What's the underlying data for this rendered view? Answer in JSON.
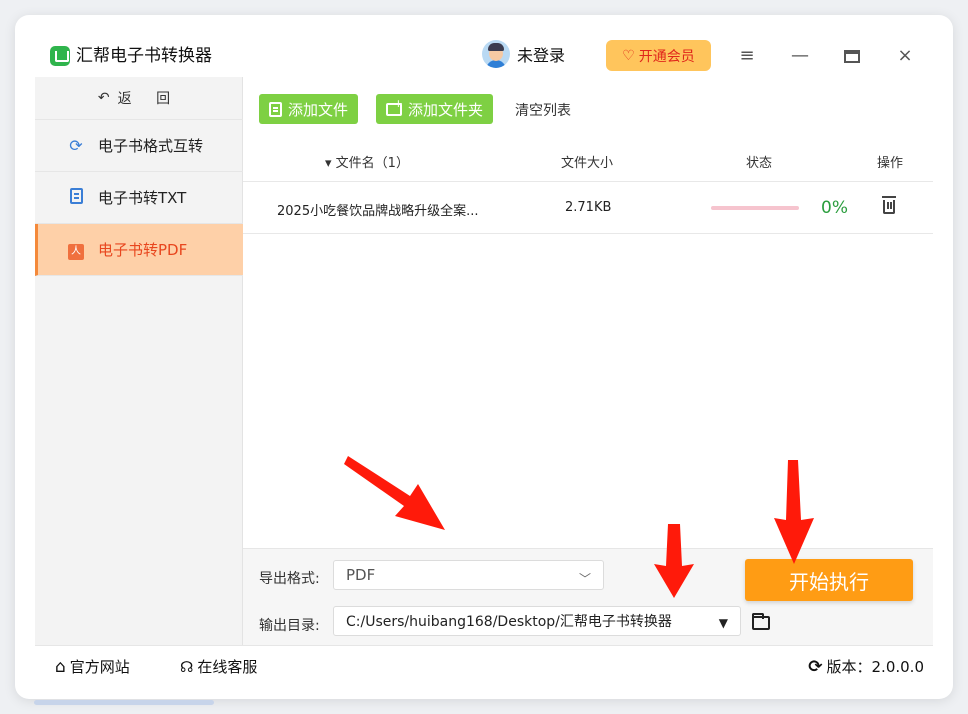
{
  "app": {
    "title": "汇帮电子书转换器",
    "user_status": "未登录",
    "vip_label": "开通会员",
    "menu_icon": "≡",
    "minimize_icon": "—",
    "close_icon": "×"
  },
  "sidebar": {
    "back_label": "返 回",
    "items": [
      {
        "label": "电子书格式互转",
        "icon": "refresh-icon",
        "active": false
      },
      {
        "label": "电子书转TXT",
        "icon": "document-icon",
        "active": false
      },
      {
        "label": "电子书转PDF",
        "icon": "pdf-icon",
        "active": true
      }
    ]
  },
  "toolbar": {
    "add_file": "添加文件",
    "add_folder": "添加文件夹",
    "clear_list": "清空列表"
  },
  "table": {
    "columns": {
      "name": "文件名（1）",
      "size": "文件大小",
      "status": "状态",
      "action": "操作"
    },
    "rows": [
      {
        "name": "2025小吃餐饮品牌战略升级全案...",
        "size": "2.71KB",
        "progress": 0,
        "progress_text": "0%"
      }
    ]
  },
  "output": {
    "format_label": "导出格式:",
    "format_value": "PDF",
    "dir_label": "输出目录:",
    "dir_value": "C:/Users/huibang168/Desktop/汇帮电子书转换器"
  },
  "start_button": "开始执行",
  "footer": {
    "website": "官方网站",
    "support": "在线客服",
    "version": "版本：2.0.0.0"
  },
  "colors": {
    "accent_green": "#7ed043",
    "start_orange": "#ff9c14",
    "active_tab_bg": "#fed0a8",
    "active_tab_text": "#e8461e",
    "progress_text": "#2a9d3d",
    "annotation_arrow": "#ff1a0a"
  }
}
